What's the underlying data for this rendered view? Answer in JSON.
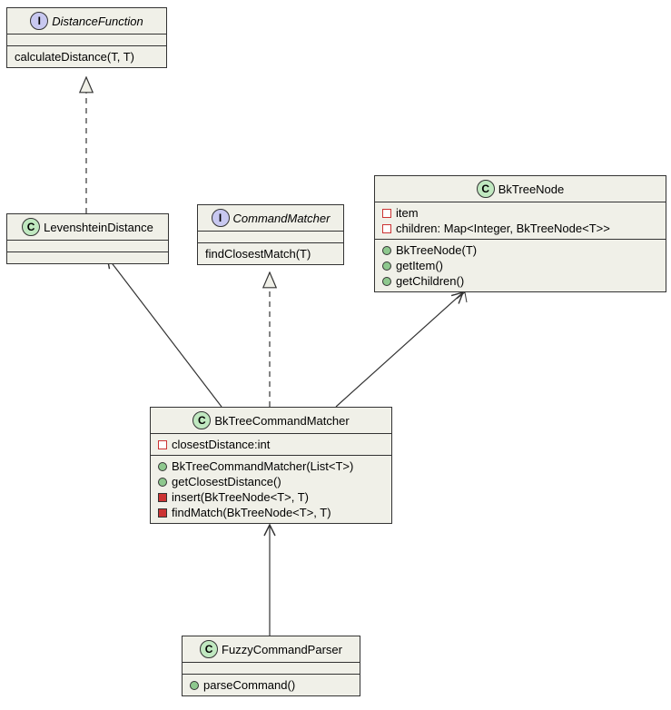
{
  "chart_data": {
    "type": "uml-class-diagram",
    "classes": [
      {
        "id": "DistanceFunction",
        "stereotype": "interface",
        "attributes": [],
        "methods": [
          "calculateDistance(T, T)"
        ]
      },
      {
        "id": "LevenshteinDistance",
        "stereotype": "class",
        "attributes": [],
        "methods": []
      },
      {
        "id": "CommandMatcher",
        "stereotype": "interface",
        "attributes": [],
        "methods": [
          "findClosestMatch(T)"
        ]
      },
      {
        "id": "BkTreeNode",
        "stereotype": "class",
        "attributes": [
          "item",
          "children: Map<Integer, BkTreeNode<T>>"
        ],
        "methods": [
          "BkTreeNode(T)",
          "getItem()",
          "getChildren()"
        ]
      },
      {
        "id": "BkTreeCommandMatcher",
        "stereotype": "class",
        "attributes": [
          "closestDistance:int"
        ],
        "methods": [
          "BkTreeCommandMatcher(List<T>)",
          "getClosestDistance()",
          "insert(BkTreeNode<T>, T)",
          "findMatch(BkTreeNode<T>, T)"
        ]
      },
      {
        "id": "FuzzyCommandParser",
        "stereotype": "class",
        "attributes": [],
        "methods": [
          "parseCommand()"
        ]
      }
    ],
    "relations": [
      {
        "from": "LevenshteinDistance",
        "to": "DistanceFunction",
        "type": "realization"
      },
      {
        "from": "BkTreeCommandMatcher",
        "to": "CommandMatcher",
        "type": "realization"
      },
      {
        "from": "BkTreeCommandMatcher",
        "to": "LevenshteinDistance",
        "type": "association"
      },
      {
        "from": "BkTreeCommandMatcher",
        "to": "BkTreeNode",
        "type": "association-many"
      },
      {
        "from": "FuzzyCommandParser",
        "to": "BkTreeCommandMatcher",
        "type": "association"
      }
    ]
  },
  "distanceFunction": {
    "badge": "I",
    "name": "DistanceFunction",
    "method1": "calculateDistance(T, T)"
  },
  "levenshtein": {
    "badge": "C",
    "name": "LevenshteinDistance"
  },
  "commandMatcher": {
    "badge": "I",
    "name": "CommandMatcher",
    "method1": "findClosestMatch(T)"
  },
  "bkTreeNode": {
    "badge": "C",
    "name": "BkTreeNode",
    "attr1": "item",
    "attr2": "children: Map<Integer, BkTreeNode<T>>",
    "m1": "BkTreeNode(T)",
    "m2": "getItem()",
    "m3": "getChildren()"
  },
  "bkMatcher": {
    "badge": "C",
    "name": "BkTreeCommandMatcher",
    "attr1": "closestDistance:int",
    "m1": "BkTreeCommandMatcher(List<T>)",
    "m2": "getClosestDistance()",
    "m3": "insert(BkTreeNode<T>, T)",
    "m4": "findMatch(BkTreeNode<T>, T)"
  },
  "fuzzyParser": {
    "badge": "C",
    "name": "FuzzyCommandParser",
    "m1": "parseCommand()"
  }
}
